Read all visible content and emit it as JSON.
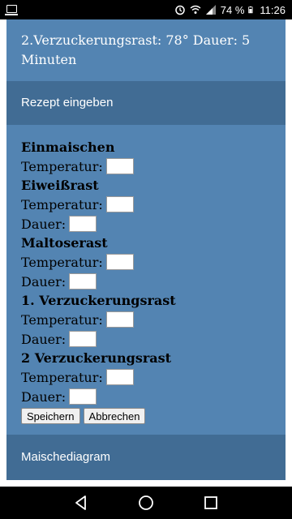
{
  "status_bar": {
    "battery_percent": "74 %",
    "time": "11:26",
    "icons": [
      "notification-icon",
      "alarm-icon",
      "wifi-icon",
      "signal-icon",
      "battery-icon"
    ]
  },
  "top_text": "2.Verzuckerungsrast: 78° Dauer: 5 Minuten",
  "rezept_bar_label": "Rezept eingeben",
  "form": {
    "einmaischen": {
      "heading": "Einmaischen",
      "temperatur_label": "Temperatur:",
      "temperatur_value": ""
    },
    "eiweissrast": {
      "heading": "Eiweißrast",
      "temperatur_label": "Temperatur:",
      "temperatur_value": "",
      "dauer_label": "Dauer:",
      "dauer_value": ""
    },
    "maltoserast": {
      "heading": "Maltoserast",
      "temperatur_label": "Temperatur:",
      "temperatur_value": "",
      "dauer_label": "Dauer:",
      "dauer_value": ""
    },
    "verzuckerungsrast1": {
      "heading": "1. Verzuckerungsrast",
      "temperatur_label": "Temperatur:",
      "temperatur_value": "",
      "dauer_label": "Dauer:",
      "dauer_value": ""
    },
    "verzuckerungsrast2": {
      "heading": "2 Verzuckerungsrast",
      "temperatur_label": "Temperatur:",
      "temperatur_value": "",
      "dauer_label": "Dauer:",
      "dauer_value": ""
    },
    "save_label": "Speichern",
    "cancel_label": "Abbrechen"
  },
  "diagram_bar_label": "Maischediagram",
  "colors": {
    "page_background": "#5384b2",
    "bar_background": "#416c94"
  }
}
